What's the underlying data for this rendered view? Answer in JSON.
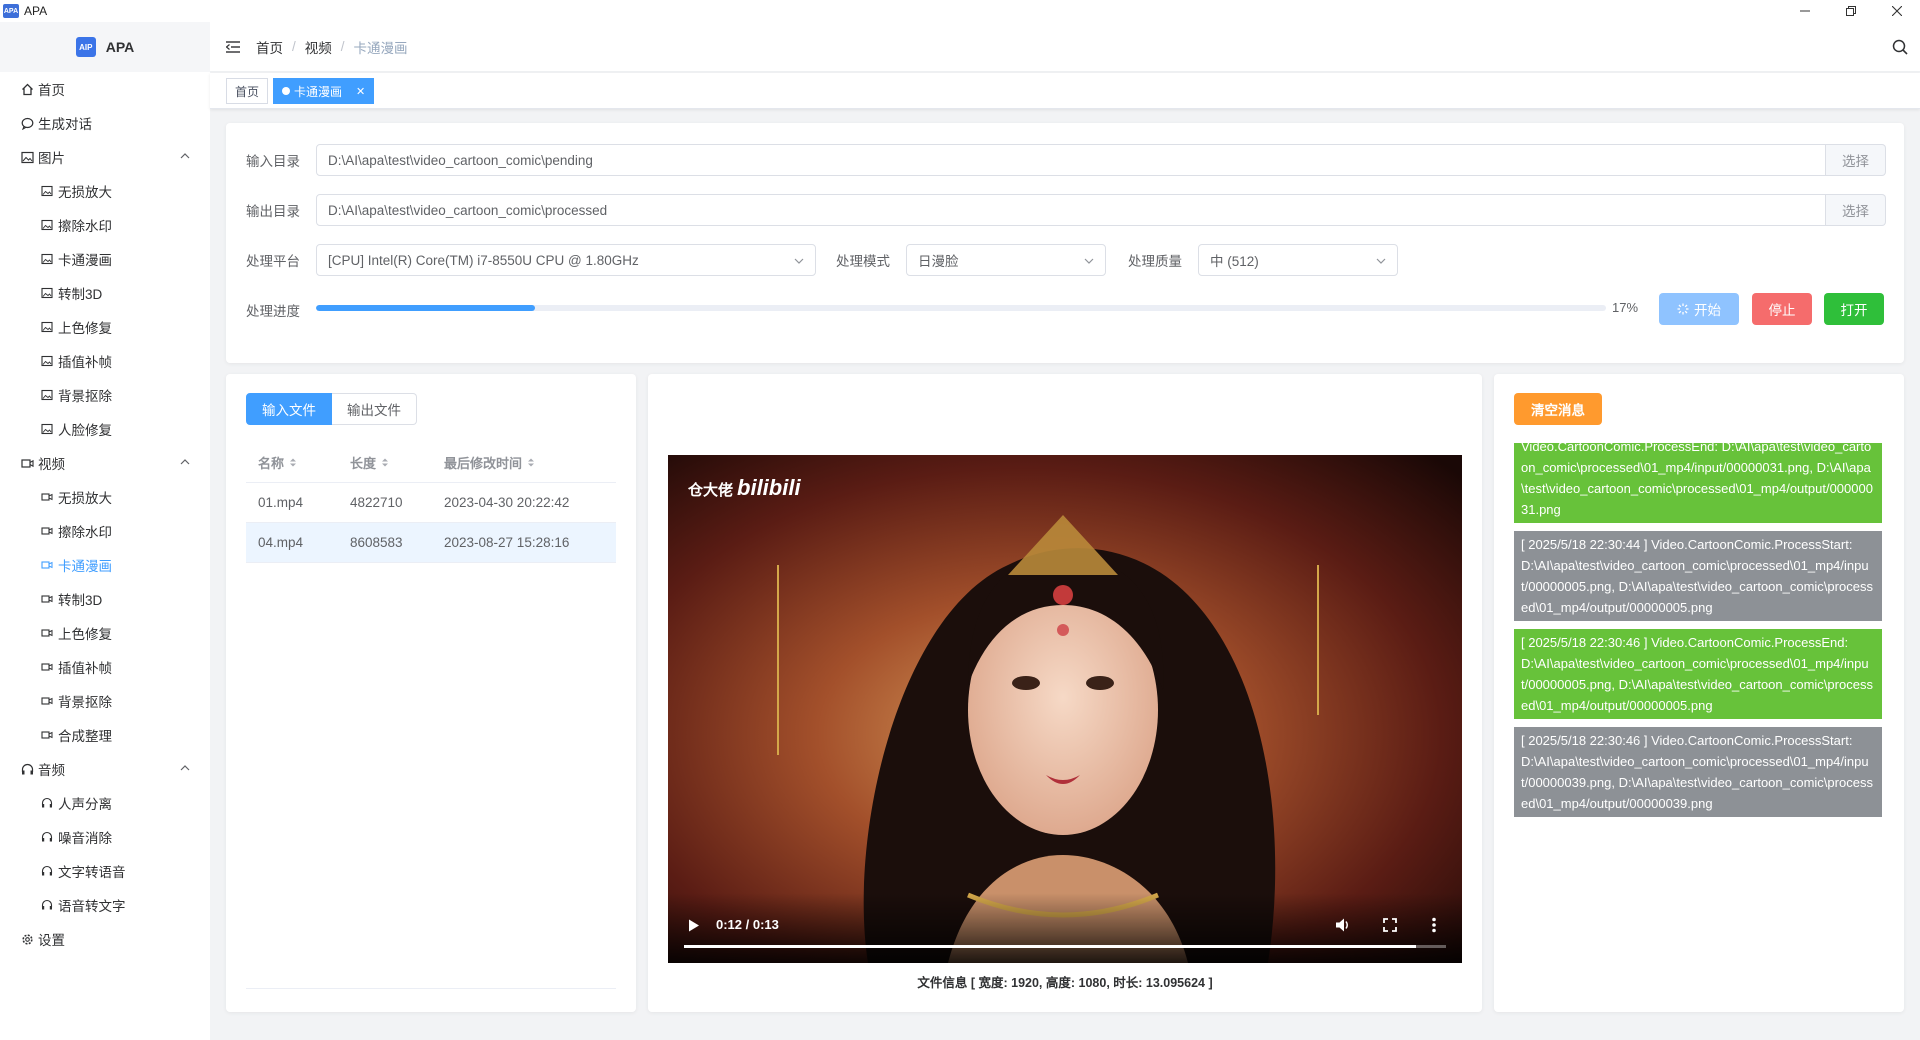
{
  "window": {
    "icon_text": "APA",
    "title": "APA"
  },
  "brand": {
    "logo_text": "AIP",
    "name": "APA"
  },
  "menu": {
    "home": "首页",
    "chat": "生成对话",
    "image": {
      "label": "图片",
      "items": [
        "无损放大",
        "擦除水印",
        "卡通漫画",
        "转制3D",
        "上色修复",
        "插值补帧",
        "背景抠除",
        "人脸修复"
      ]
    },
    "video": {
      "label": "视频",
      "items": [
        "无损放大",
        "擦除水印",
        "卡通漫画",
        "转制3D",
        "上色修复",
        "插值补帧",
        "背景抠除",
        "合成整理"
      ],
      "active_index": 2
    },
    "audio": {
      "label": "音频",
      "items": [
        "人声分离",
        "噪音消除",
        "文字转语音",
        "语音转文字"
      ]
    },
    "settings": "设置"
  },
  "breadcrumb": [
    "首页",
    "视频",
    "卡通漫画"
  ],
  "tags": {
    "home": "首页",
    "active": "卡通漫画"
  },
  "form": {
    "input_dir_label": "输入目录",
    "input_dir_value": "D:\\AI\\apa\\test\\video_cartoon_comic\\pending",
    "output_dir_label": "输出目录",
    "output_dir_value": "D:\\AI\\apa\\test\\video_cartoon_comic\\processed",
    "choose_label": "选择",
    "platform_label": "处理平台",
    "platform_value": "[CPU] Intel(R) Core(TM) i7-8550U CPU @ 1.80GHz",
    "mode_label": "处理模式",
    "mode_value": "日漫脸",
    "quality_label": "处理质量",
    "quality_value": "中 (512)",
    "progress_label": "处理进度",
    "progress_percent": 17,
    "progress_text": "17%",
    "start_label": "开始",
    "stop_label": "停止",
    "open_label": "打开"
  },
  "files": {
    "tab_input": "输入文件",
    "tab_output": "输出文件",
    "columns": [
      "名称",
      "长度",
      "最后修改时间"
    ],
    "rows": [
      {
        "name": "01.mp4",
        "size": "4822710",
        "mtime": "2023-04-30 20:22:42"
      },
      {
        "name": "04.mp4",
        "size": "8608583",
        "mtime": "2023-08-27 15:28:16"
      }
    ],
    "selected_index": 1
  },
  "video": {
    "watermark_cn": "仓大佬",
    "watermark_logo": "bilibili",
    "time": "0:12 / 0:13",
    "position_fraction": 0.96,
    "info": "文件信息 [ 宽度: 1920, 高度: 1080, 时长: 13.095624 ]"
  },
  "messages": {
    "clear_label": "清空消息",
    "items": [
      {
        "type": "green",
        "text": "Video.CartoonComic.ProcessEnd: D:\\AI\\apa\\test\\video_cartoon_comic\\processed\\01_mp4/input/00000031.png, D:\\AI\\apa\\test\\video_cartoon_comic\\processed\\01_mp4/output/00000031.png"
      },
      {
        "type": "gray",
        "text": "[ 2025/5/18 22:30:44 ] Video.CartoonComic.ProcessStart: D:\\AI\\apa\\test\\video_cartoon_comic\\processed\\01_mp4/input/00000005.png, D:\\AI\\apa\\test\\video_cartoon_comic\\processed\\01_mp4/output/00000005.png"
      },
      {
        "type": "green",
        "text": "[ 2025/5/18 22:30:46 ] Video.CartoonComic.ProcessEnd: D:\\AI\\apa\\test\\video_cartoon_comic\\processed\\01_mp4/input/00000005.png, D:\\AI\\apa\\test\\video_cartoon_comic\\processed\\01_mp4/output/00000005.png"
      },
      {
        "type": "gray",
        "text": "[ 2025/5/18 22:30:46 ] Video.CartoonComic.ProcessStart: D:\\AI\\apa\\test\\video_cartoon_comic\\processed\\01_mp4/input/00000039.png, D:\\AI\\apa\\test\\video_cartoon_comic\\processed\\01_mp4/output/00000039.png"
      }
    ]
  },
  "colors": {
    "primary": "#409eff",
    "start_btn": "#8fc3ff",
    "stop_btn": "#f56c6c",
    "open_btn": "#2fbf3a",
    "msg_green": "#67c23a",
    "msg_gray": "#8d9196",
    "clear_btn": "#ff9a2e"
  }
}
